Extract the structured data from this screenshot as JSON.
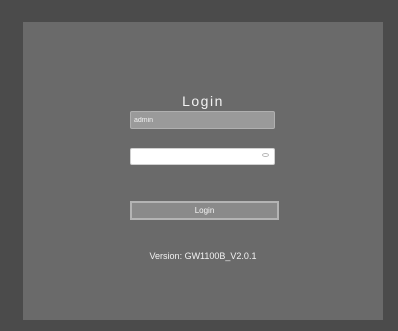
{
  "login": {
    "title": "Login",
    "username_value": "admin",
    "password_value": "",
    "button_label": "Login",
    "version_text": "Version: GW1100B_V2.0.1"
  },
  "icons": {
    "password_toggle": "eye-icon"
  }
}
